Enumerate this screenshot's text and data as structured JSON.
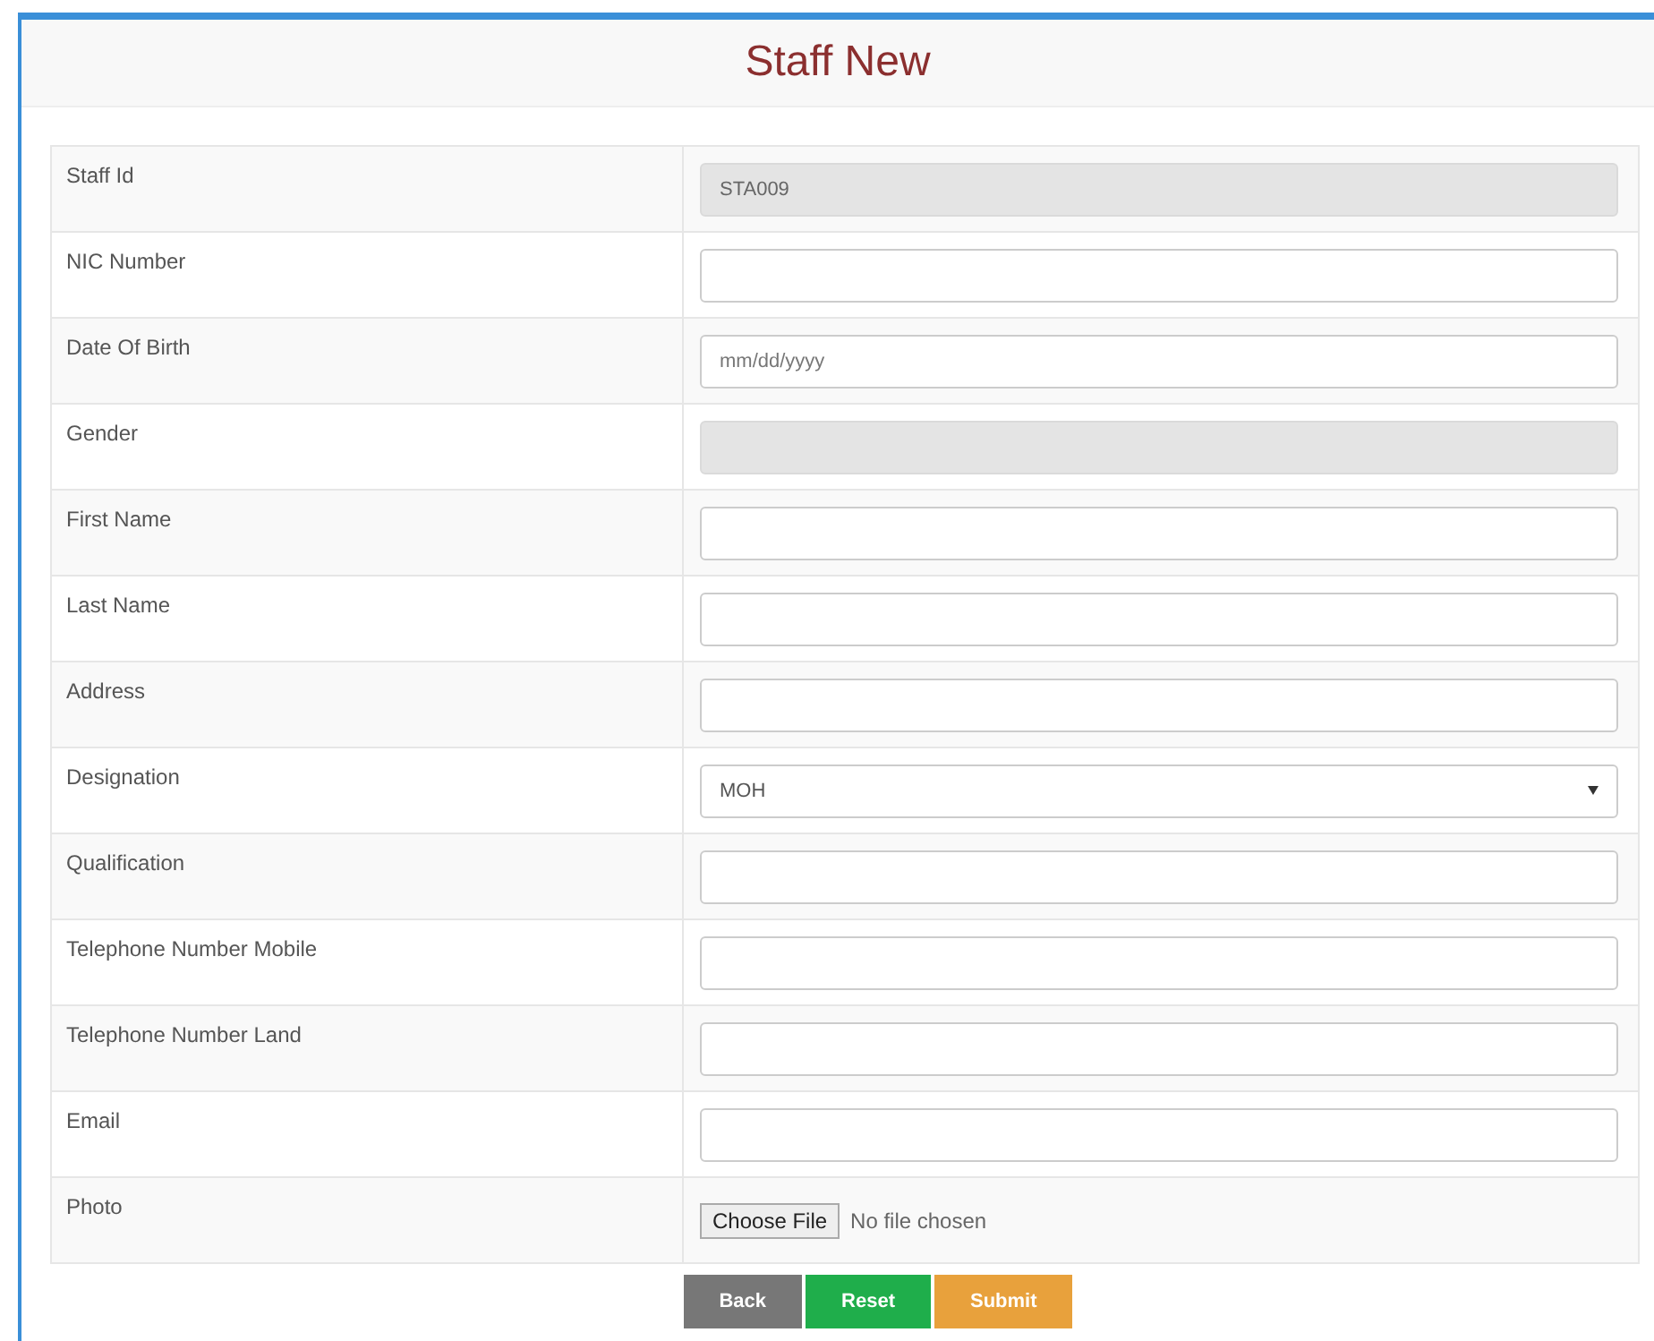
{
  "panel": {
    "title": "Staff New"
  },
  "fields": [
    {
      "label": "Staff Id",
      "kind": "text",
      "value": "STA009",
      "disabled": true
    },
    {
      "label": "NIC Number",
      "kind": "text",
      "disabled": false
    },
    {
      "label": "Date Of Birth",
      "kind": "text",
      "placeholder": "mm/dd/yyyy",
      "disabled": false
    },
    {
      "label": "Gender",
      "kind": "select",
      "disabled": true
    },
    {
      "label": "First Name",
      "kind": "text",
      "disabled": false
    },
    {
      "label": "Last Name",
      "kind": "text",
      "disabled": false
    },
    {
      "label": "Address",
      "kind": "text",
      "disabled": false
    },
    {
      "label": "Designation",
      "kind": "select",
      "value": "MOH",
      "disabled": false
    },
    {
      "label": "Qualification",
      "kind": "text",
      "disabled": false
    },
    {
      "label": "Telephone Number Mobile",
      "kind": "text",
      "disabled": false
    },
    {
      "label": "Telephone Number Land",
      "kind": "text",
      "disabled": false
    },
    {
      "label": "Email",
      "kind": "text",
      "disabled": false
    },
    {
      "label": "Photo",
      "kind": "file",
      "button": "Choose File",
      "status": "No file chosen"
    }
  ],
  "buttons": [
    {
      "label": "Back",
      "color": "#777777"
    },
    {
      "label": "Reset",
      "color": "#1fae4b"
    },
    {
      "label": "Submit",
      "color": "#e8a13c"
    }
  ]
}
